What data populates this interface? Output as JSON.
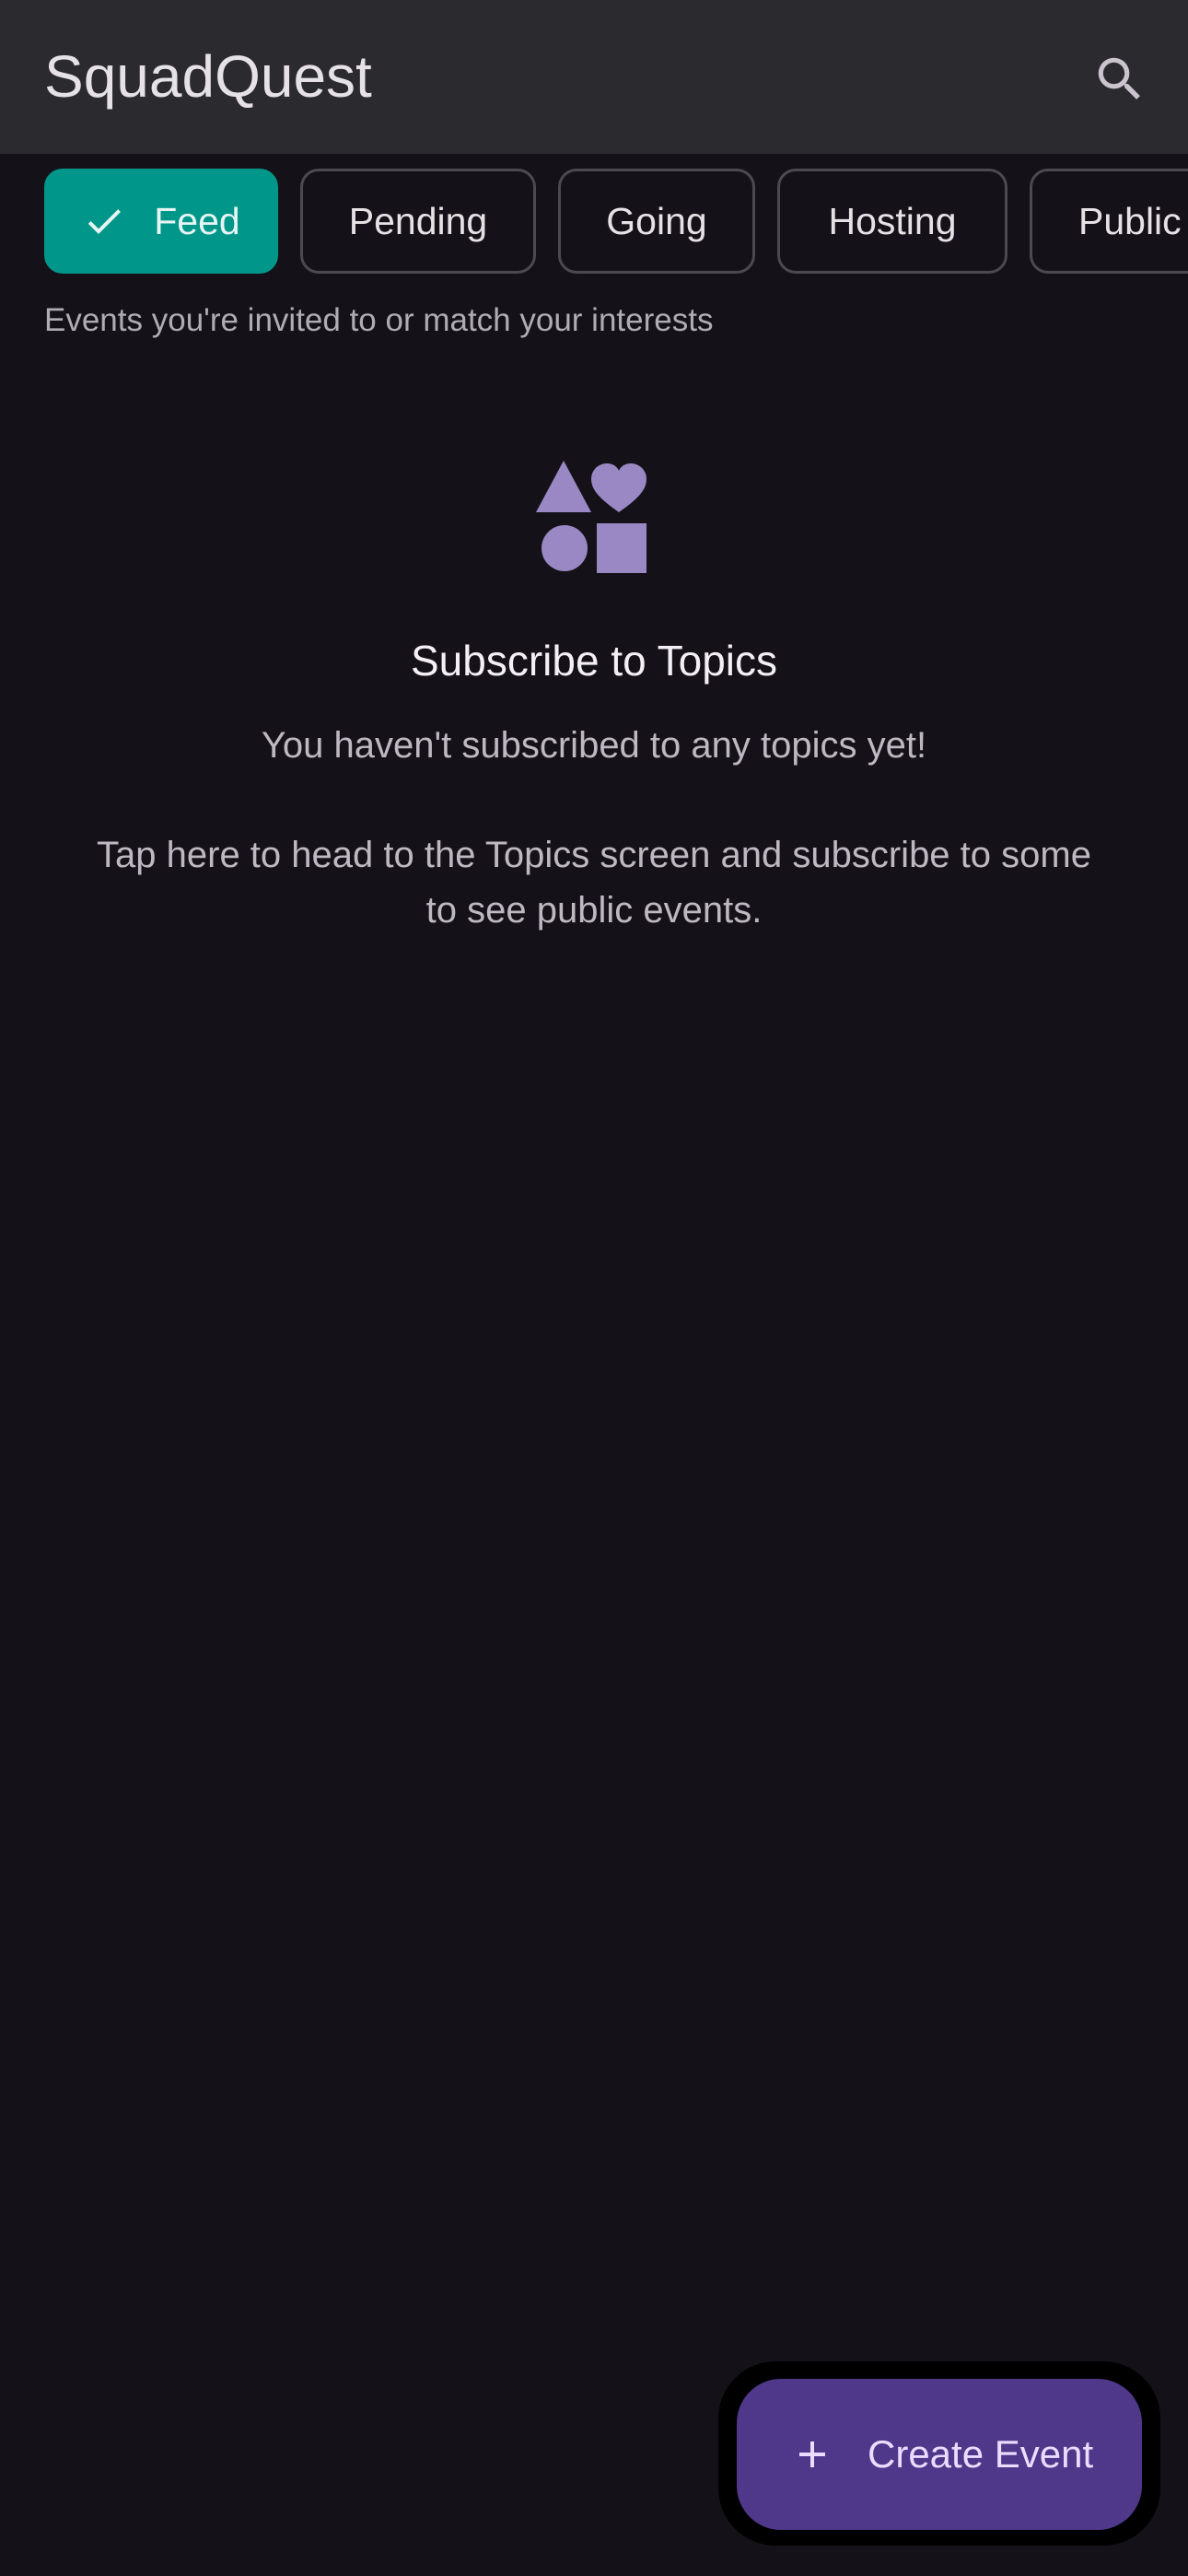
{
  "app_bar": {
    "title": "SquadQuest",
    "search_icon": "search-icon"
  },
  "filters": {
    "chips": [
      {
        "label": "Feed",
        "selected": true,
        "icon": "check-icon"
      },
      {
        "label": "Pending",
        "selected": false
      },
      {
        "label": "Going",
        "selected": false
      },
      {
        "label": "Hosting",
        "selected": false
      },
      {
        "label": "Public",
        "selected": false
      }
    ],
    "description": "Events you're invited to or match your interests"
  },
  "empty_state": {
    "icon": "shapes-icon",
    "title": "Subscribe to Topics",
    "line1": "You haven't subscribed to any topics yet!",
    "line2": "Tap here to head to the Topics screen and subscribe to some to see public events."
  },
  "fab": {
    "label": "Create Event",
    "icon": "plus-icon"
  },
  "colors": {
    "background": "#141218",
    "app_bar": "#2b2a2f",
    "chip_selected": "#00968a",
    "chip_border": "#4c4950",
    "accent_icon": "#9a88c4",
    "fab": "#4f378a"
  }
}
